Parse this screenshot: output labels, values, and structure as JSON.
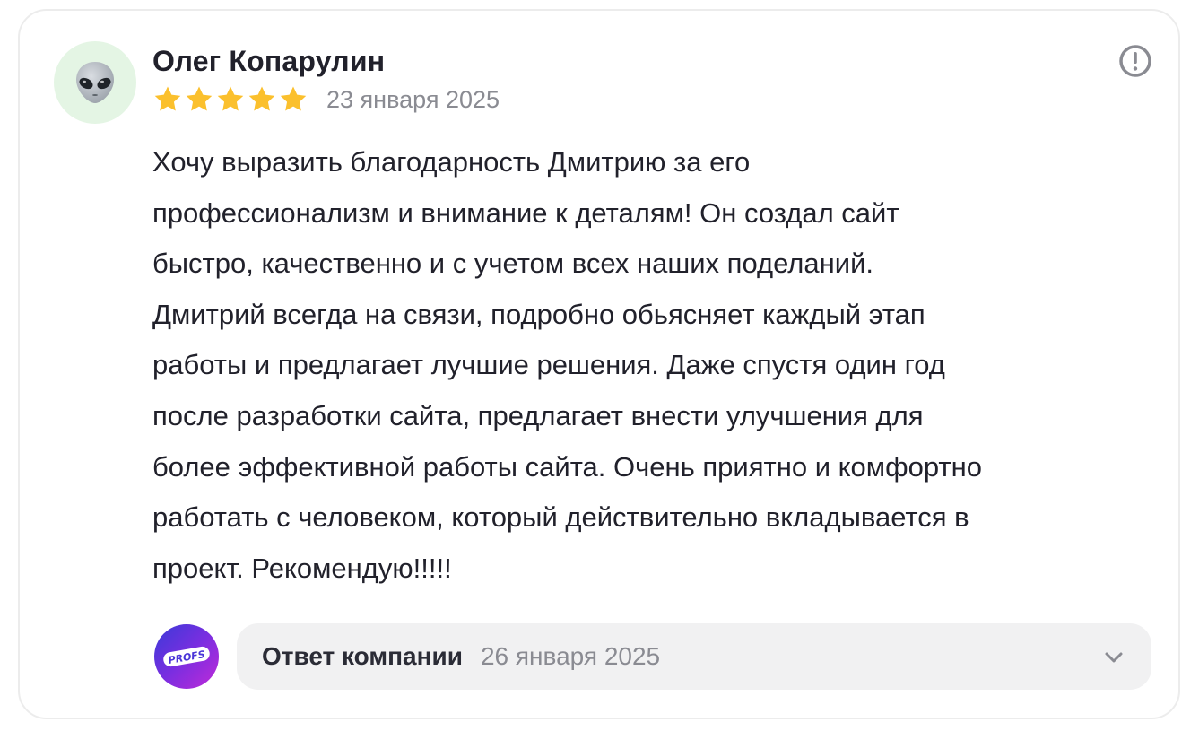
{
  "review": {
    "author": "Олег Копарулин",
    "avatar_icon": "alien-emoji-icon",
    "rating": 5,
    "rating_max": 5,
    "date": "23 января 2025",
    "text": "Хочу выразить благодарность Дмитрию за его\nпрофессионализм и внимание к деталям! Он создал сайт\nбыстро, качественно и с учетом всех наших поделаний.\nДмитрий всегда на связи, подробно обьясняет каждый этап\nработы и предлагает лучшие решения. Даже спустя один год\nпосле разработки сайта, предлагает внести улучшения для\nболее эффективной работы сайта. Очень приятно и комфортно\nработать с человеком, который действительно вкладывается в\nпроект. Рекомендую!!!!!"
  },
  "company_reply": {
    "logo_text": "PROFS",
    "label": "Ответ компании",
    "date": "26 января 2025"
  },
  "colors": {
    "star": "#fbc02d",
    "text": "#21212b",
    "muted": "#8a8b92",
    "reply_bg": "#f1f1f2",
    "avatar_bg": "#e4f5e4"
  }
}
